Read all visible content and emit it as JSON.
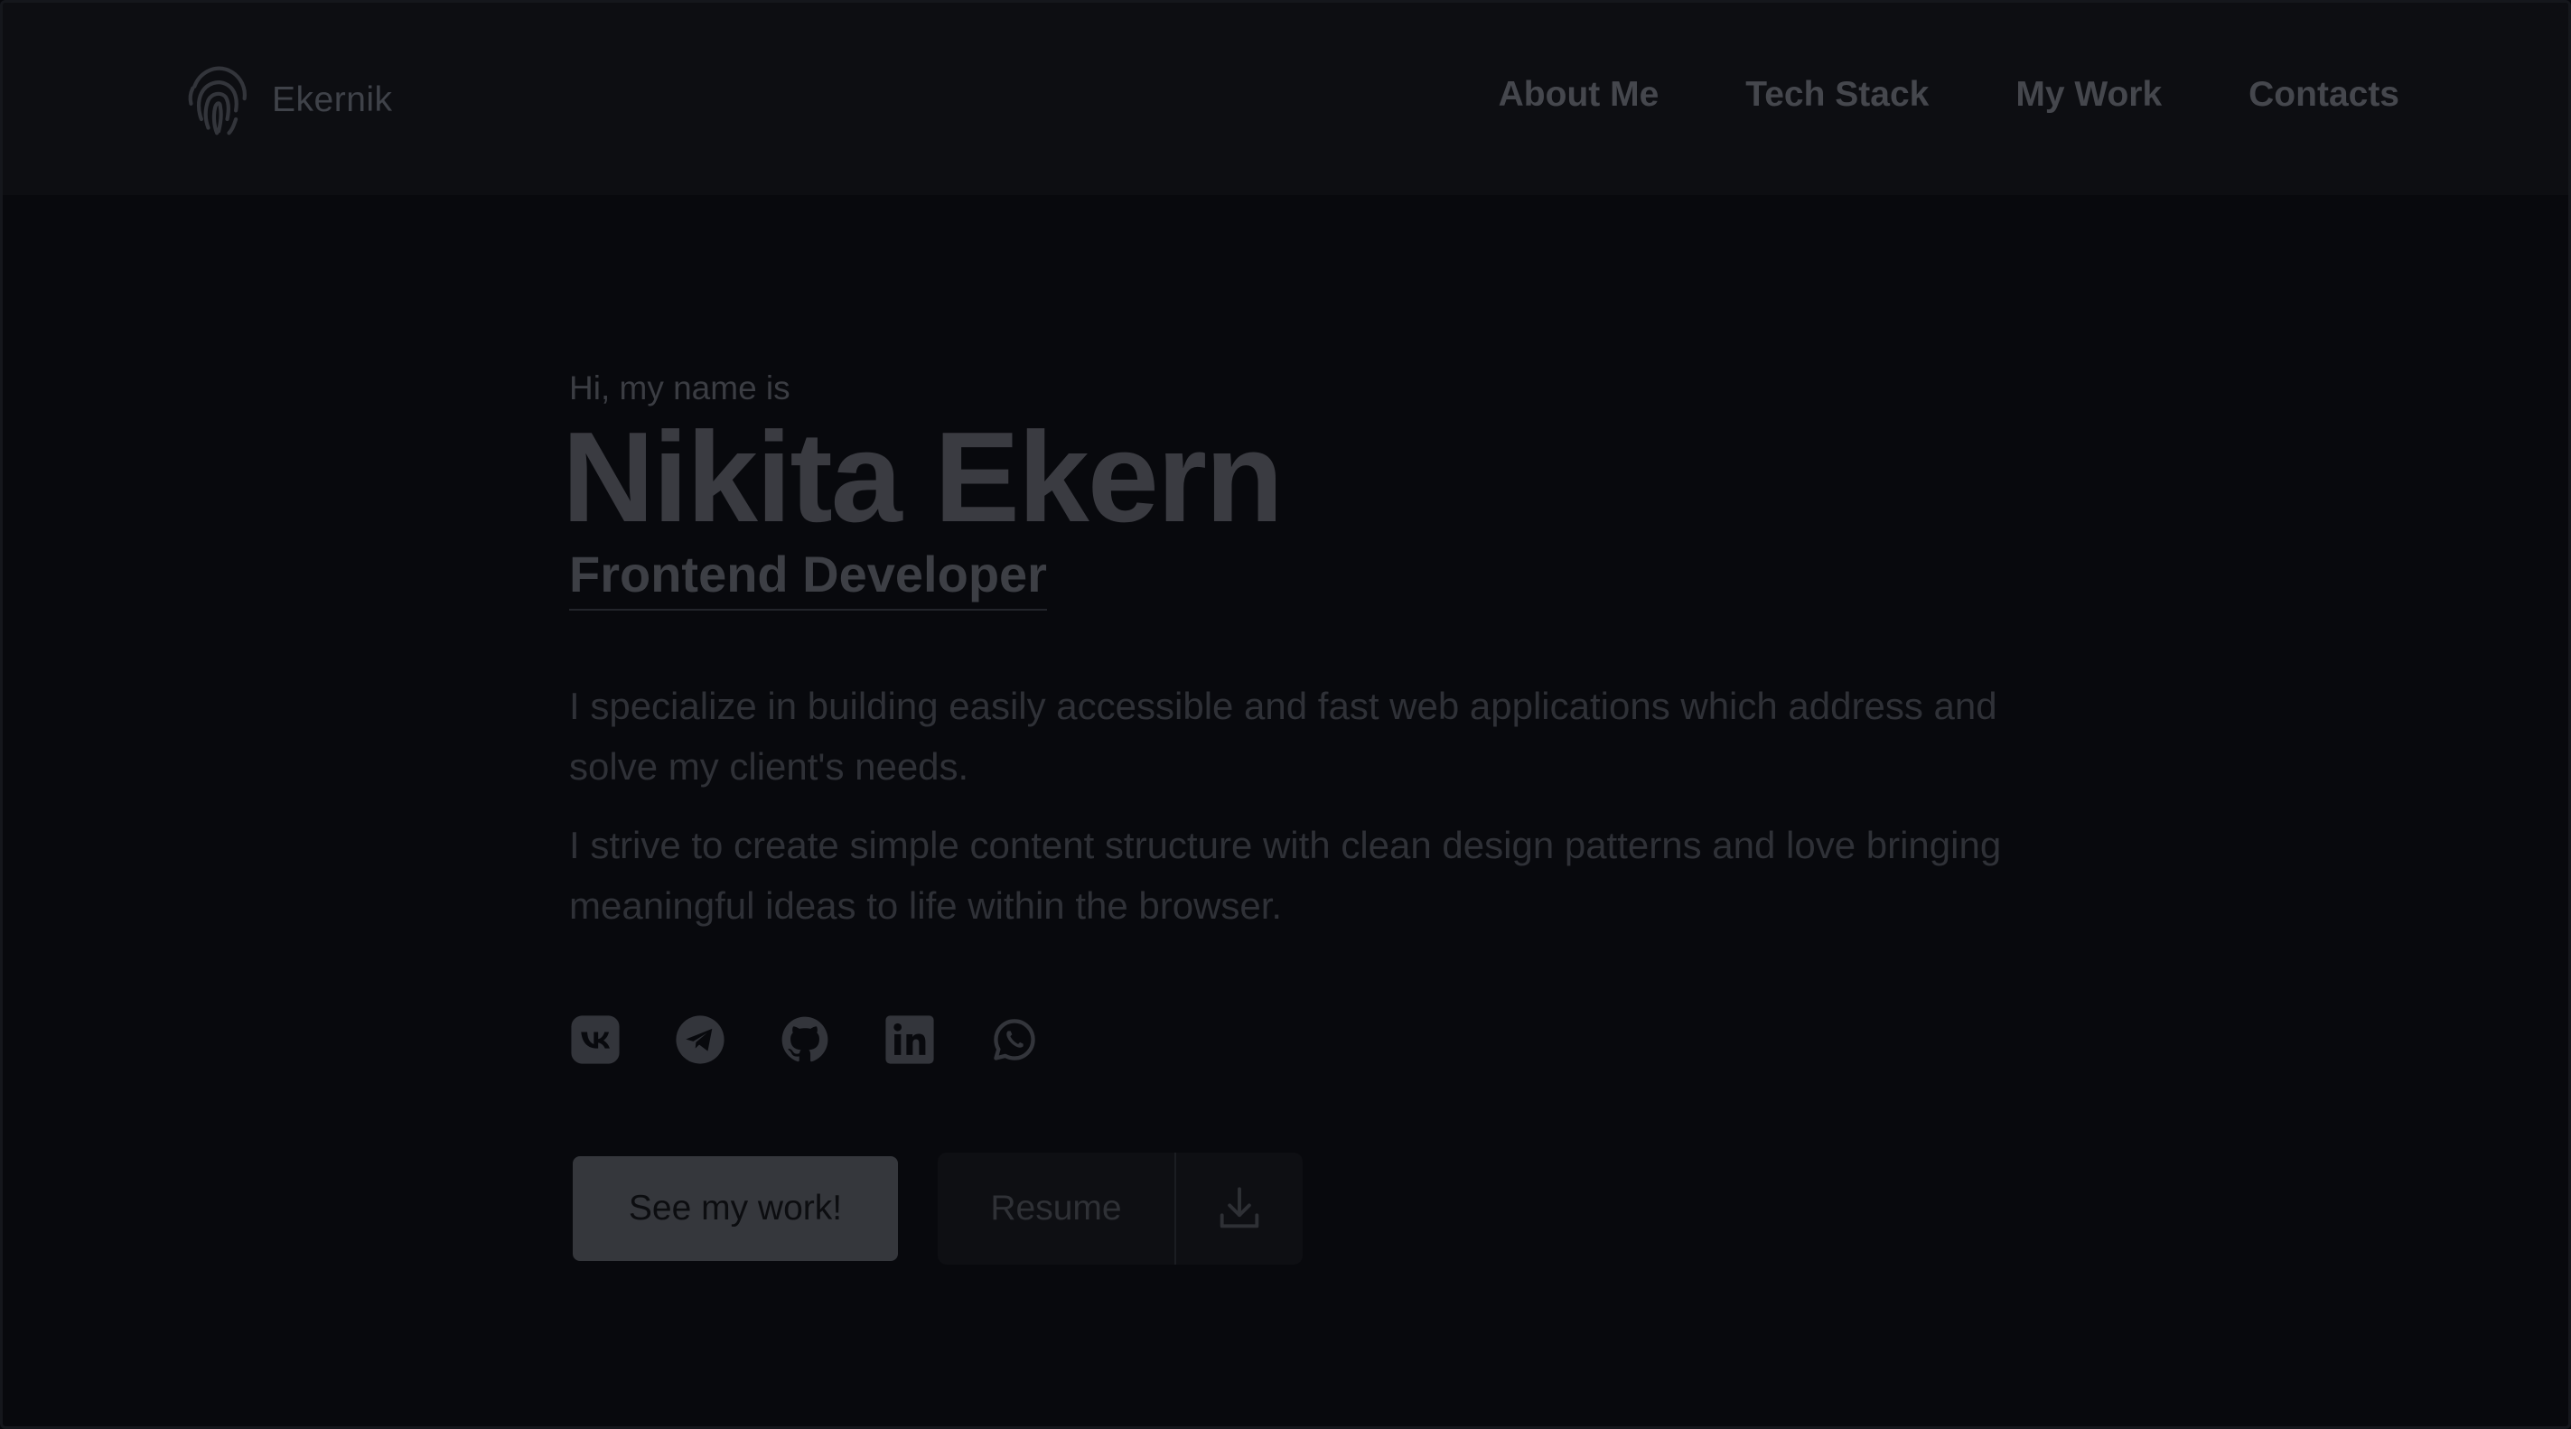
{
  "brand": {
    "name": "Ekernik",
    "logo_icon": "fingerprint-icon"
  },
  "nav": {
    "items": [
      {
        "label": "About Me"
      },
      {
        "label": "Tech Stack"
      },
      {
        "label": "My Work"
      },
      {
        "label": "Contacts"
      }
    ]
  },
  "hero": {
    "greeting": "Hi, my name is",
    "name": "Nikita Ekern",
    "role": "Frontend Developer",
    "paragraphs": [
      "I specialize in building easily accessible and fast web applications which address and solve my client's needs.",
      "I strive to create simple content structure with clean design patterns and love bringing meaningful ideas to life within the browser."
    ]
  },
  "socials": [
    {
      "icon": "vk-icon"
    },
    {
      "icon": "telegram-icon"
    },
    {
      "icon": "github-icon"
    },
    {
      "icon": "linkedin-icon"
    },
    {
      "icon": "whatsapp-icon"
    }
  ],
  "buttons": {
    "primary_label": "See my work!",
    "resume_label": "Resume",
    "resume_icon": "download-icon"
  },
  "colors": {
    "background": "#08090d",
    "header_background": "#0d0e12",
    "primary_button": "#35373c",
    "text_muted": "#3a3b41"
  }
}
